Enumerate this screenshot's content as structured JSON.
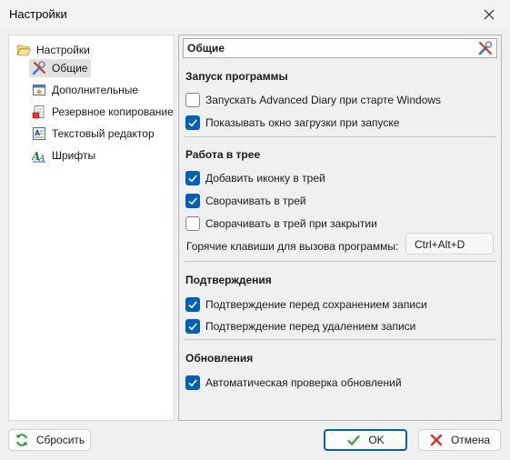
{
  "window": {
    "title": "Настройки"
  },
  "tree": {
    "root_label": "Настройки",
    "items": [
      {
        "label": "Общие",
        "icon": "tools-icon",
        "selected": true
      },
      {
        "label": "Дополнительные",
        "icon": "window-icon",
        "selected": false
      },
      {
        "label": "Резервное копирование",
        "icon": "backup-icon",
        "selected": false
      },
      {
        "label": "Текстовый редактор",
        "icon": "text-editor-icon",
        "selected": false
      },
      {
        "label": "Шрифты",
        "icon": "font-icon",
        "selected": false
      }
    ]
  },
  "panel": {
    "header": "Общие",
    "sections": {
      "startup": {
        "title": "Запуск программы",
        "options": [
          {
            "label": "Запускать Advanced Diary при старте Windows",
            "checked": false
          },
          {
            "label": "Показывать окно загрузки при запуске",
            "checked": true
          }
        ]
      },
      "tray": {
        "title": "Работа в трее",
        "options": [
          {
            "label": "Добавить иконку в трей",
            "checked": true
          },
          {
            "label": "Сворачивать в трей",
            "checked": true
          },
          {
            "label": "Сворачивать в трей при закрытии",
            "checked": false
          }
        ],
        "hotkey_label": "Горячие клавиши для вызова программы:",
        "hotkey_value": "Ctrl+Alt+D"
      },
      "confirm": {
        "title": "Подтверждения",
        "options": [
          {
            "label": "Подтверждение перед сохранением записи",
            "checked": true
          },
          {
            "label": "Подтверждение перед удалением записи",
            "checked": true
          }
        ]
      },
      "updates": {
        "title": "Обновления",
        "options": [
          {
            "label": "Автоматическая проверка обновлений",
            "checked": true
          }
        ]
      }
    }
  },
  "buttons": {
    "reset": "Сбросить",
    "ok": "OK",
    "cancel": "Отмена"
  },
  "colors": {
    "accent": "#005fb8",
    "selection": "#e1e1e1"
  }
}
